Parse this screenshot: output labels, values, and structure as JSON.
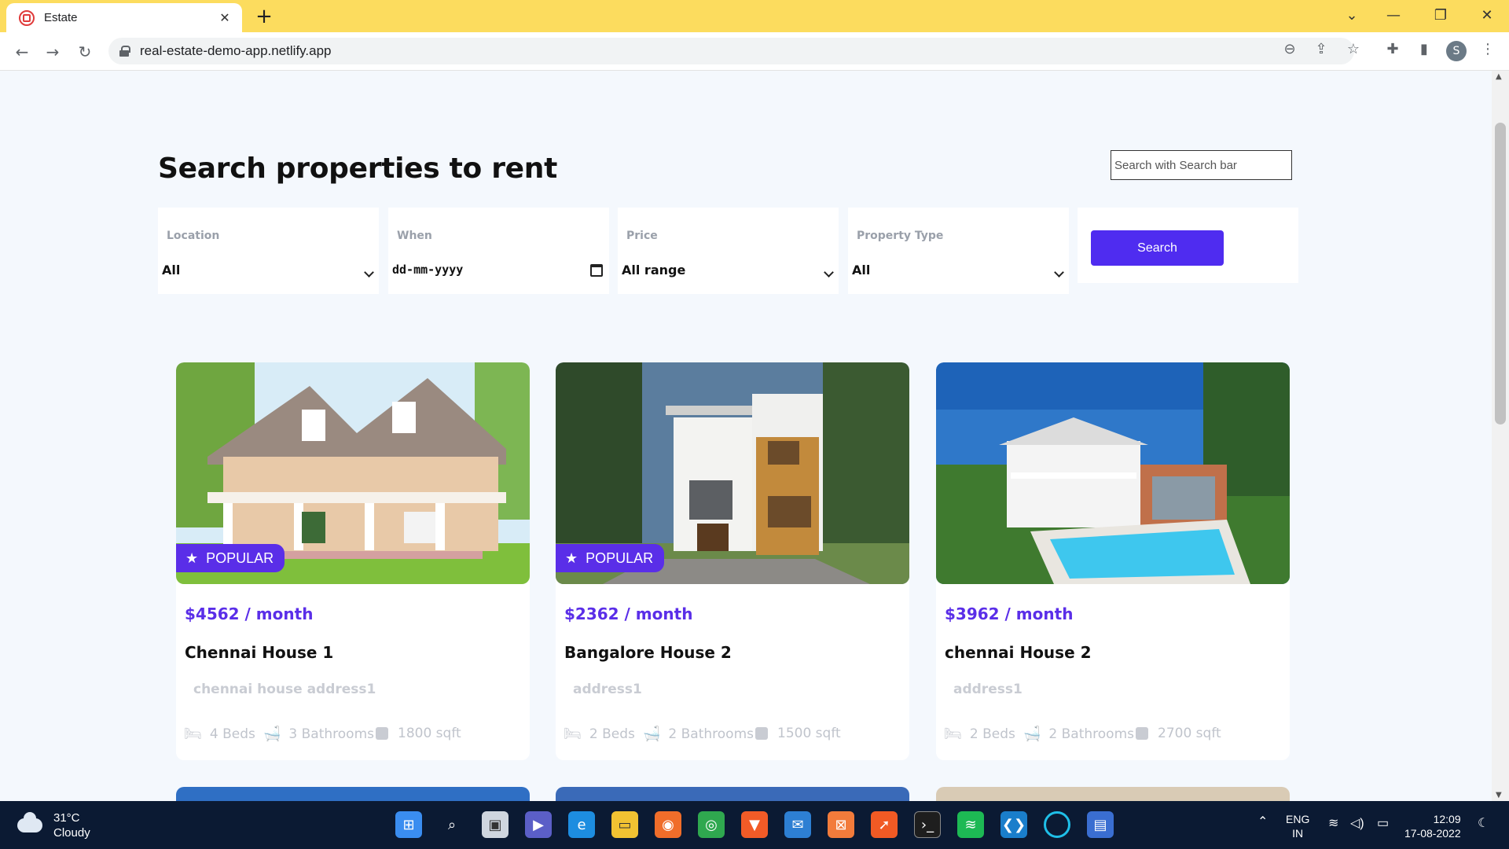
{
  "browser": {
    "tab_title": "Estate",
    "url": "real-estate-demo-app.netlify.app"
  },
  "page": {
    "title": "Search properties to rent",
    "search_placeholder": "Search with Search bar"
  },
  "filters": {
    "location": {
      "label": "Location",
      "value": "All"
    },
    "when": {
      "label": "When",
      "value": "dd-mm-yyyy"
    },
    "price": {
      "label": "Price",
      "value": "All range"
    },
    "property_type": {
      "label": "Property Type",
      "value": "All"
    },
    "search_label": "Search"
  },
  "colors": {
    "accent": "#4f2cf0",
    "price": "#5a2ee8",
    "tabbar": "#fcdc5e"
  },
  "listings": [
    {
      "badge": "POPULAR",
      "price": "$4562 / month",
      "name": "Chennai House 1",
      "address": "chennai house address1",
      "beds": "4 Beds",
      "baths": "3 Bathrooms",
      "area": "1800 sqft"
    },
    {
      "badge": "POPULAR",
      "price": "$2362 / month",
      "name": "Bangalore House 2",
      "address": "address1",
      "beds": "2 Beds",
      "baths": "2 Bathrooms",
      "area": "1500 sqft"
    },
    {
      "badge": "",
      "price": "$3962 / month",
      "name": "chennai House 2",
      "address": "address1",
      "beds": "2 Beds",
      "baths": "2 Bathrooms",
      "area": "2700 sqft"
    }
  ],
  "taskbar": {
    "weather_temp": "31°C",
    "weather_desc": "Cloudy",
    "lang_top": "ENG",
    "lang_bottom": "IN",
    "time": "12:09",
    "date": "17-08-2022"
  }
}
